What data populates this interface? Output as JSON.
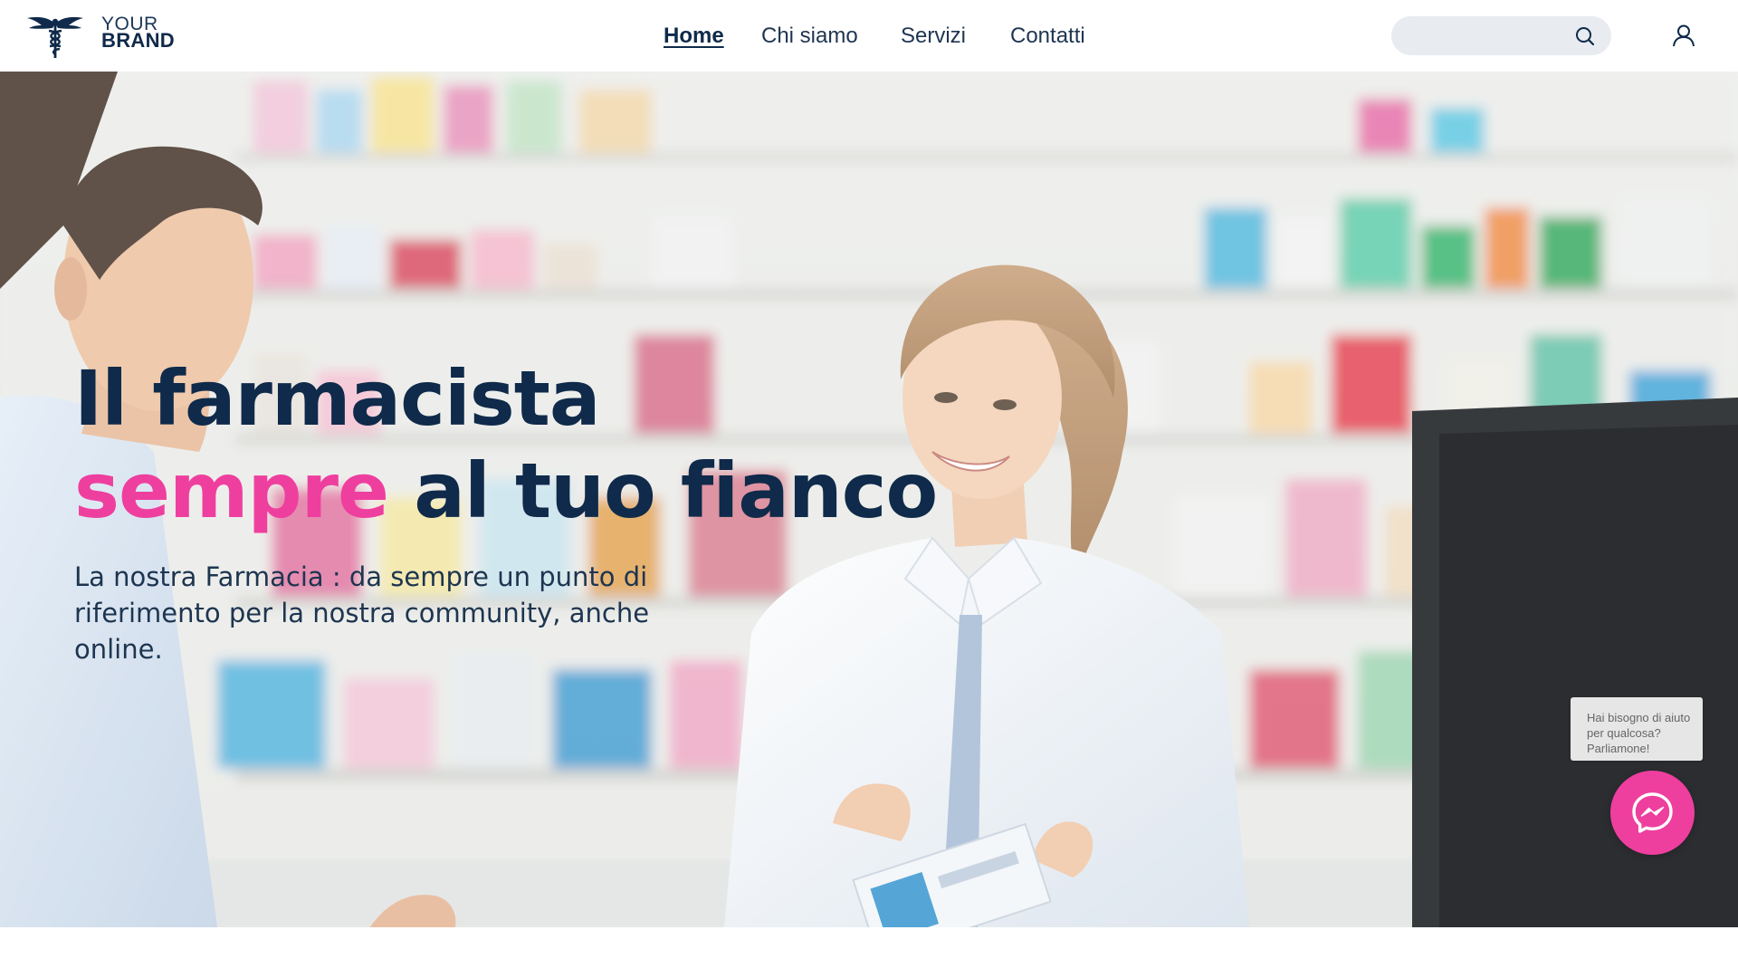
{
  "brand": {
    "line1": "YOUR",
    "line2": "BRAND",
    "icon": "caduceus-icon"
  },
  "nav": {
    "items": [
      {
        "label": "Home",
        "active": true
      },
      {
        "label": "Chi siamo",
        "active": false
      },
      {
        "label": "Servizi",
        "active": false
      },
      {
        "label": "Contatti",
        "active": false
      }
    ]
  },
  "search": {
    "placeholder": "",
    "value": "",
    "icon": "search-icon"
  },
  "account": {
    "icon": "user-icon"
  },
  "hero": {
    "title_line1": "Il farmacista",
    "title_highlight": "sempre",
    "title_line2_rest": " al tuo fianco",
    "subtitle": "La nostra Farmacia : da sempre un punto di riferimento per la nostra community, anche online."
  },
  "chat": {
    "tooltip": "Hai bisogno di aiuto per qualcosa? Parliamone!",
    "icon": "messenger-icon"
  },
  "colors": {
    "primary": "#0f2a4a",
    "accent": "#ee3f9f",
    "search_bg": "#e8ebf0"
  }
}
